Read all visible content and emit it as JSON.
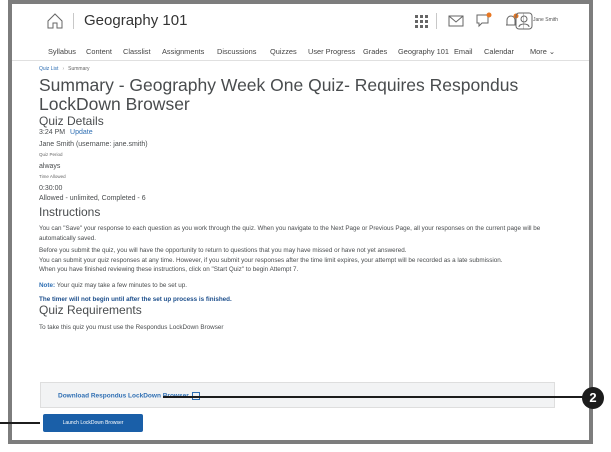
{
  "header": {
    "course_title": "Geography 101",
    "user_name": "Jane Smith"
  },
  "nav": {
    "items": [
      "Syllabus",
      "Content",
      "Classlist",
      "Assignments",
      "Discussions",
      "Quizzes",
      "User Progress",
      "Grades",
      "Geography 101",
      "Email",
      "Calendar",
      "More"
    ]
  },
  "breadcrumb": {
    "parent": "Quiz List",
    "current": "Summary"
  },
  "page": {
    "title": "Summary - Geography Week One Quiz- Requires Respondus LockDown Browser"
  },
  "quiz_details": {
    "heading": "Quiz Details",
    "time": "3:24 PM",
    "update_label": "Update",
    "user": "Jane Smith (username: jane.smith)",
    "period_label": "Quiz Period",
    "period_value": "always",
    "time_allowed_label": "Time Allowed",
    "time_allowed_value": "0:30:00",
    "attempts": "Allowed - unlimited, Completed - 6"
  },
  "instructions": {
    "heading": "Instructions",
    "p1": "You can \"Save\" your response to each question as you work through the quiz. When you navigate to the Next Page or Previous Page, all your responses on the current page will be automatically saved.",
    "p2": "Before you submit the quiz, you will have the opportunity to return to questions that you may have missed or have not yet answered.",
    "p3": "You can submit your quiz responses at any time. However, if you submit your responses after the time limit expires, your attempt will be recorded as a late submission.",
    "p4": "When you have finished reviewing these instructions, click on \"Start Quiz\" to begin Attempt 7.",
    "note_label": "Note:",
    "note_text": "Your quiz may take a few minutes to be set up.",
    "timer_text": "The timer will not begin until after the set up process is finished."
  },
  "requirements": {
    "heading": "Quiz Requirements",
    "text": "To take this quiz you must use the Respondus LockDown Browser",
    "download_label": "Download Respondus LockDown Browser",
    "launch_label": "Launch LockDown Browser"
  },
  "callout": {
    "number": "2"
  },
  "colors": {
    "link": "#2f6fb3",
    "button": "#1a5fa8",
    "frame": "#7d7d7d"
  }
}
